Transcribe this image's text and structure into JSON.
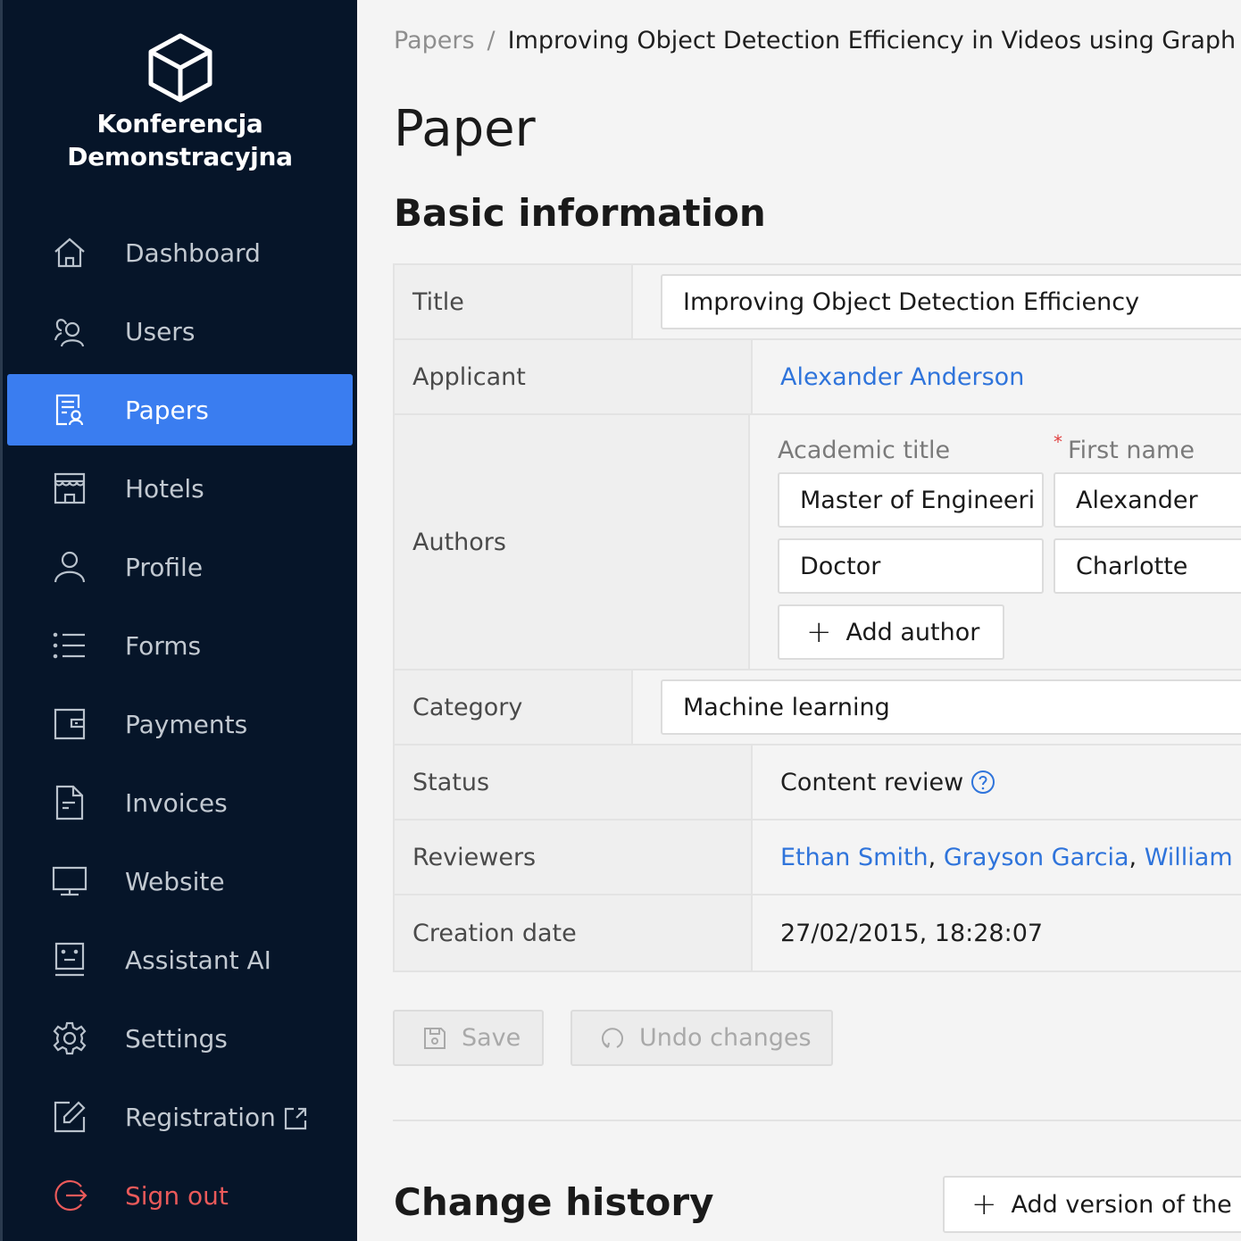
{
  "brand": {
    "logo_icon": "cube-icon",
    "line1": "Konferencja",
    "line2": "Demonstracyjna"
  },
  "sidebar": {
    "items": [
      {
        "label": "Dashboard",
        "icon": "home-icon",
        "active": false
      },
      {
        "label": "Users",
        "icon": "users-icon",
        "active": false
      },
      {
        "label": "Papers",
        "icon": "paper-user-icon",
        "active": true
      },
      {
        "label": "Hotels",
        "icon": "store-icon",
        "active": false
      },
      {
        "label": "Profile",
        "icon": "user-icon",
        "active": false
      },
      {
        "label": "Forms",
        "icon": "list-icon",
        "active": false
      },
      {
        "label": "Payments",
        "icon": "wallet-icon",
        "active": false
      },
      {
        "label": "Invoices",
        "icon": "document-icon",
        "active": false
      },
      {
        "label": "Website",
        "icon": "monitor-icon",
        "active": false
      },
      {
        "label": "Assistant AI",
        "icon": "robot-icon",
        "active": false
      },
      {
        "label": "Settings",
        "icon": "gear-icon",
        "active": false
      },
      {
        "label": "Registration",
        "icon": "edit-icon",
        "active": false,
        "external": true
      },
      {
        "label": "Sign out",
        "icon": "sign-out-icon",
        "active": false
      }
    ]
  },
  "colors": {
    "sidebar_bg": "#061529",
    "accent": "#3a7df0",
    "link": "#2f74db",
    "danger": "#ea5a5a"
  },
  "breadcrumb": {
    "parent": "Papers",
    "separator": "/",
    "current": "Improving Object Detection Efficiency in Videos using Graph Ne"
  },
  "page": {
    "title": "Paper",
    "section_basic": "Basic information",
    "section_history": "Change history"
  },
  "fields": {
    "title": {
      "label": "Title",
      "value": "Improving Object Detection Efficiency"
    },
    "applicant": {
      "label": "Applicant",
      "value": "Alexander Anderson"
    },
    "authors": {
      "label": "Authors",
      "col_academic_title": "Academic title",
      "col_first_name": "First name",
      "required_mark": "*",
      "rows": [
        {
          "academic_title": "Master of Engineeri",
          "first_name": "Alexander"
        },
        {
          "academic_title": "Doctor",
          "first_name": "Charlotte"
        }
      ],
      "add_label": "Add author"
    },
    "category": {
      "label": "Category",
      "value": "Machine learning"
    },
    "status": {
      "label": "Status",
      "value": "Content review"
    },
    "reviewers": {
      "label": "Reviewers",
      "names": [
        "Ethan Smith",
        "Grayson Garcia",
        "William M"
      ]
    },
    "creation_date": {
      "label": "Creation date",
      "value": "27/02/2015, 18:28:07"
    }
  },
  "actions": {
    "save_label": "Save",
    "undo_label": "Undo changes",
    "add_version_label": "Add version of the p"
  }
}
